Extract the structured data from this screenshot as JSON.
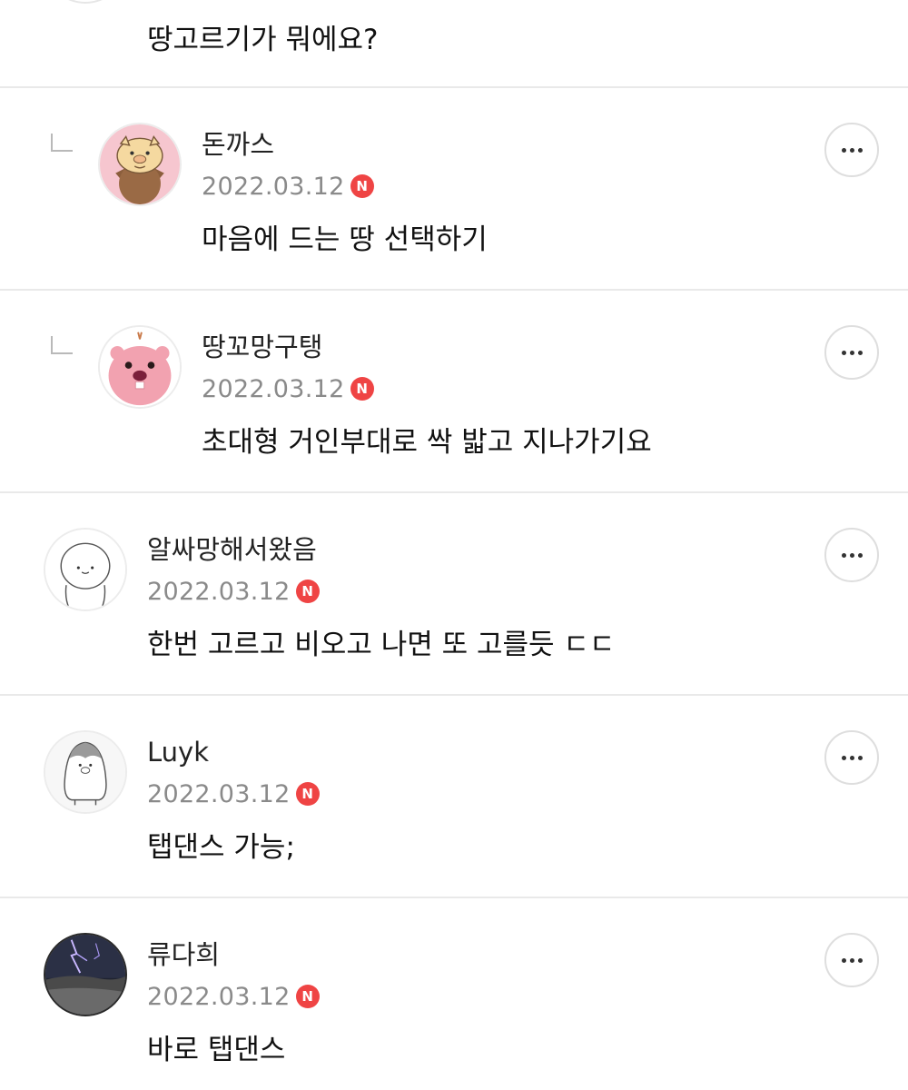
{
  "top_comment": {
    "text": "땅고르기가 뭐에요?"
  },
  "comments": [
    {
      "author": "돈까스",
      "date": "2022.03.12",
      "badge": "N",
      "text": "마음에 드는 땅 선택하기",
      "reply": true
    },
    {
      "author": "땅꼬망구탱",
      "date": "2022.03.12",
      "badge": "N",
      "text": "초대형 거인부대로 싹 밟고 지나가기요",
      "reply": true
    },
    {
      "author": "알싸망해서왔음",
      "date": "2022.03.12",
      "badge": "N",
      "text": "한번 고르고 비오고 나면 또 고를듯 ㄷㄷ",
      "reply": false
    },
    {
      "author": "Luyk",
      "date": "2022.03.12",
      "badge": "N",
      "text": "탭댄스 가능;",
      "reply": false
    },
    {
      "author": "류다희",
      "date": "2022.03.12",
      "badge": "N",
      "text": "바로 탭댄스",
      "reply": false
    }
  ],
  "icons": {
    "more": "more-options-icon",
    "reply": "reply-arrow-icon",
    "new": "new-badge-icon"
  },
  "colors": {
    "badge": "#ef4444",
    "date": "#8a8a8a",
    "divider": "#e9e9e9"
  }
}
